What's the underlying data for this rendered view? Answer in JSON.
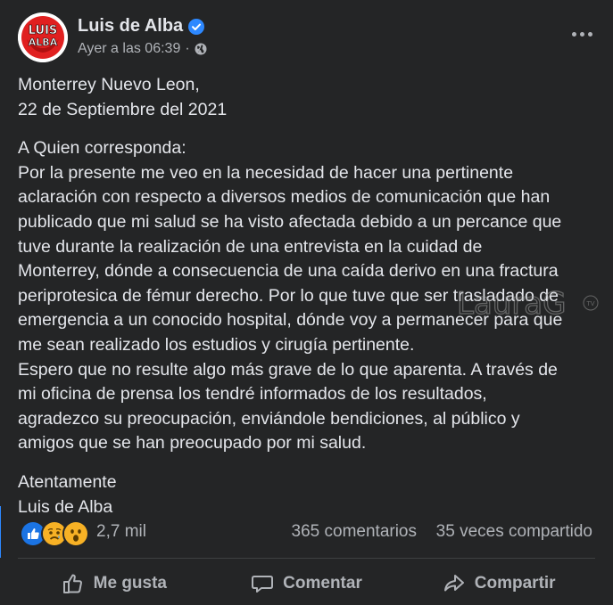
{
  "post": {
    "author": "Luis de Alba",
    "avatar_text_top": "LUIS",
    "avatar_text_bottom": "ALBA",
    "timestamp": "Ayer a las 06:39",
    "separator": "·",
    "privacy_icon": "globe-icon",
    "verified_icon": "verified-badge-icon",
    "more_icon": "more-options-icon"
  },
  "content": {
    "paragraphs": [
      [
        "Monterrey Nuevo Leon,",
        "22 de Septiembre del 2021"
      ],
      [
        "A Quien corresponda:",
        "Por la presente me veo en la necesidad de hacer una pertinente",
        "aclaración con respecto a diversos medios de comunicación que  han",
        "publicado que mi salud se ha visto afectada debido a un percance que",
        "tuve durante la realización de una entrevista en la cuidad de",
        "Monterrey, dónde a consecuencia de una caída derivo en una fractura",
        "periprotesica de fémur derecho. Por lo que tuve que ser trasladado de",
        "emergencia a un conocido hospital, dónde voy a permanecer para que",
        "me sean realizado los estudios y cirugía pertinente.",
        "Espero que no resulte algo más grave de lo que aparenta. A través de",
        "mi oficina de prensa los tendré informados de los resultados,",
        "agradezco su preocupación, enviándole bendiciones, al público y",
        "amigos que se han preocupado por mi salud."
      ],
      [
        "Atentamente",
        "Luis de Alba"
      ]
    ]
  },
  "watermark": {
    "text": "LauraG",
    "suffix": "TV"
  },
  "stats": {
    "reactions": [
      "like-reaction-icon",
      "sad-reaction-icon",
      "wow-reaction-icon"
    ],
    "reaction_count": "2,7 mil",
    "comments": "365 comentarios",
    "shares": "35 veces compartido"
  },
  "actions": {
    "like": "Me gusta",
    "comment": "Comentar",
    "share": "Compartir"
  },
  "colors": {
    "background": "#242526",
    "text_primary": "#e4e6eb",
    "text_secondary": "#b0b3b8",
    "accent_blue": "#2d88ff"
  }
}
